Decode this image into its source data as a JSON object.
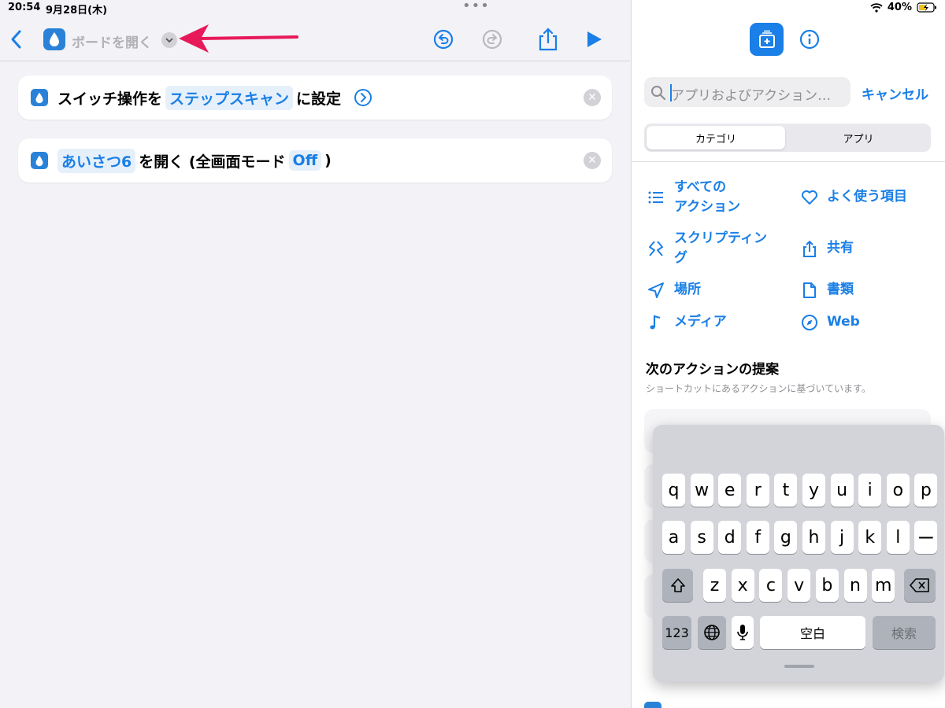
{
  "status_bar": {
    "time": "20:54",
    "date": "9月28日(木)",
    "dots": "•••",
    "battery": "40%"
  },
  "toolbar": {
    "shortcut_name": "ボードを開く"
  },
  "actions": [
    {
      "prefix": "スイッチ操作を",
      "token": "ステップスキャン",
      "suffix": "に設定"
    },
    {
      "token": "あいさつ6",
      "middle": "を開く (全画面モード",
      "token2": "Off",
      "suffix": ")"
    }
  ],
  "search": {
    "placeholder": "アプリおよびアクション…",
    "cancel": "キャンセル"
  },
  "segments": {
    "categories": "カテゴリ",
    "apps": "アプリ"
  },
  "categories": [
    {
      "line1": "すべての",
      "line2": "アクション",
      "icon": "list-icon"
    },
    {
      "line1": "よく使う項目",
      "line2": "",
      "icon": "heart-icon"
    },
    {
      "line1": "スクリプティン",
      "line2": "グ",
      "icon": "scripting-icon"
    },
    {
      "line1": "共有",
      "line2": "",
      "icon": "share-icon"
    },
    {
      "line1": "場所",
      "line2": "",
      "icon": "location-icon"
    },
    {
      "line1": "書類",
      "line2": "",
      "icon": "document-icon"
    },
    {
      "line1": "メディア",
      "line2": "",
      "icon": "music-note-icon"
    },
    {
      "line1": "Web",
      "line2": "",
      "icon": "compass-icon"
    }
  ],
  "suggestions": {
    "title": "次のアクションの提案",
    "subtitle": "ショートカットにあるアクションに基づいています。"
  },
  "keyboard": {
    "row1": [
      "q",
      "w",
      "e",
      "r",
      "t",
      "y",
      "u",
      "i",
      "o",
      "p"
    ],
    "row2": [
      "a",
      "s",
      "d",
      "f",
      "g",
      "h",
      "j",
      "k",
      "l",
      "ー"
    ],
    "row3": [
      "z",
      "x",
      "c",
      "v",
      "b",
      "n",
      "m"
    ],
    "num_key": "123",
    "space": "空白",
    "search": "検索"
  },
  "colors": {
    "accent": "#1a7fe6",
    "arrow": "#e8195a"
  }
}
